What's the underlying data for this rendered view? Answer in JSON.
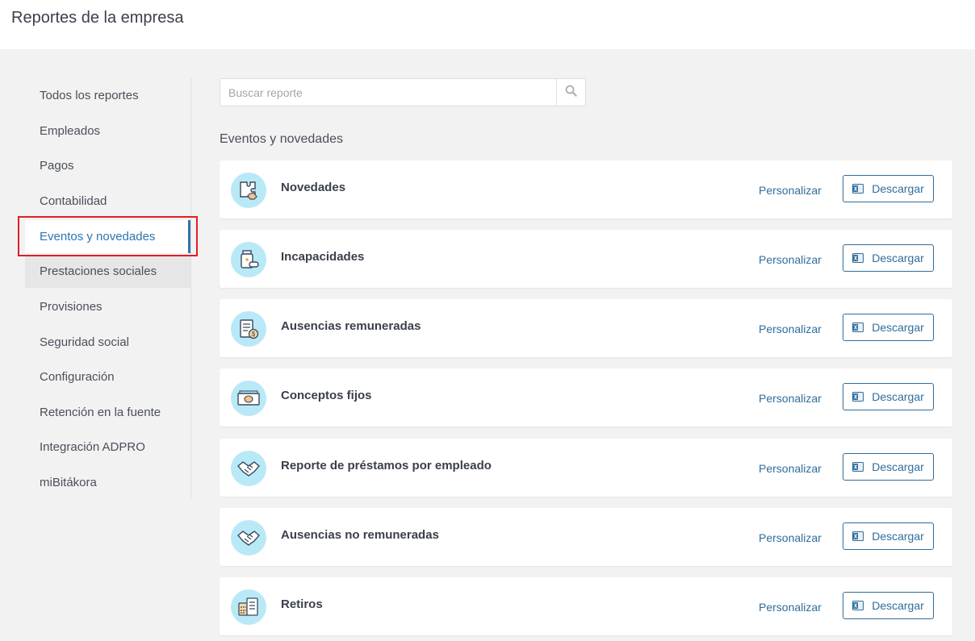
{
  "header": {
    "title": "Reportes de la empresa"
  },
  "sidebar": {
    "items": [
      {
        "label": "Todos los reportes"
      },
      {
        "label": "Empleados"
      },
      {
        "label": "Pagos"
      },
      {
        "label": "Contabilidad"
      },
      {
        "label": "Eventos y novedades"
      },
      {
        "label": "Prestaciones sociales"
      },
      {
        "label": "Provisiones"
      },
      {
        "label": "Seguridad social"
      },
      {
        "label": "Configuración"
      },
      {
        "label": "Retención en la fuente"
      },
      {
        "label": "Integración ADPRO"
      },
      {
        "label": "miBitákora"
      }
    ],
    "active_item": "Eventos y novedades"
  },
  "search": {
    "placeholder": "Buscar reporte",
    "value": "",
    "icon": "search-icon"
  },
  "section": {
    "title": "Eventos y novedades"
  },
  "reports": [
    {
      "title": "Novedades",
      "icon": "puzzle-hand-icon",
      "customize_label": "Personalizar",
      "download_label": "Descargar"
    },
    {
      "title": "Incapacidades",
      "icon": "medicine-icon",
      "customize_label": "Personalizar",
      "download_label": "Descargar"
    },
    {
      "title": "Ausencias remuneradas",
      "icon": "document-money-icon",
      "customize_label": "Personalizar",
      "download_label": "Descargar"
    },
    {
      "title": "Conceptos fijos",
      "icon": "banknotes-icon",
      "customize_label": "Personalizar",
      "download_label": "Descargar"
    },
    {
      "title": "Reporte de préstamos por empleado",
      "icon": "handshake-icon",
      "customize_label": "Personalizar",
      "download_label": "Descargar"
    },
    {
      "title": "Ausencias no remuneradas",
      "icon": "handshake-icon",
      "customize_label": "Personalizar",
      "download_label": "Descargar"
    },
    {
      "title": "Retiros",
      "icon": "calculator-document-icon",
      "customize_label": "Personalizar",
      "download_label": "Descargar"
    }
  ],
  "colors": {
    "accent": "#2f75ad",
    "link": "#2f6d9b",
    "highlight": "#e01e26",
    "icon_bg": "#b9e9f7"
  }
}
